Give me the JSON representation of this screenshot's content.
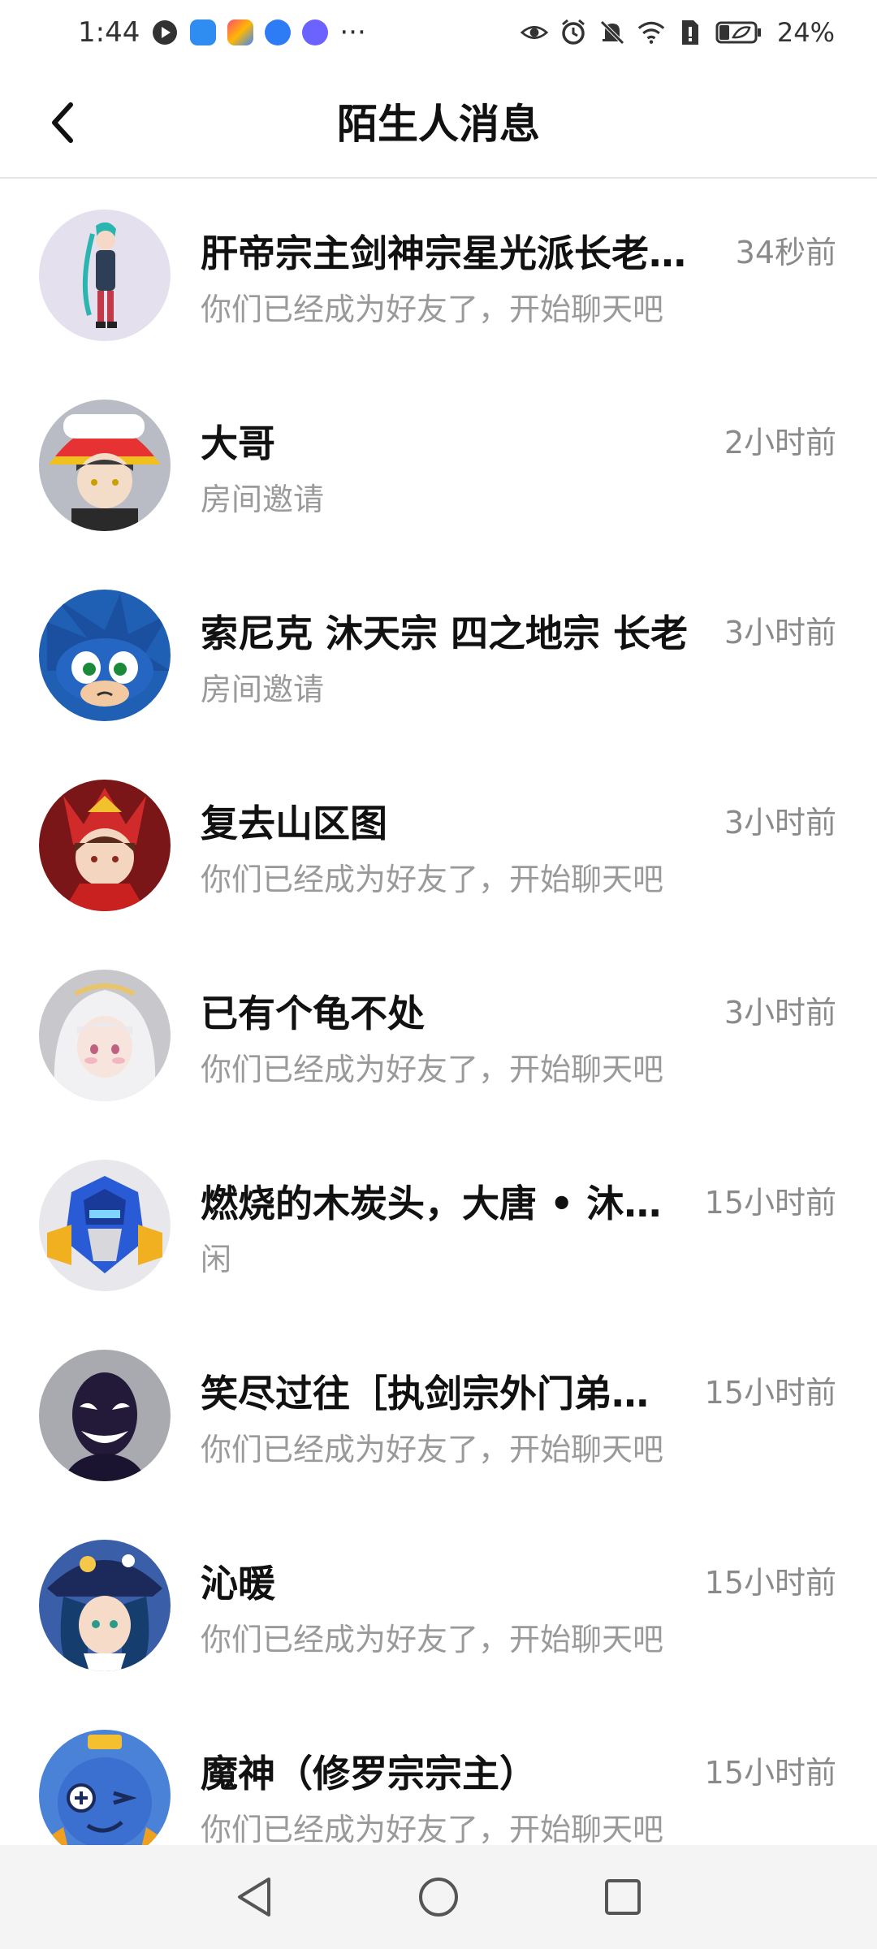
{
  "status_bar": {
    "time": "1:44",
    "ellipsis": "···",
    "battery_percent": "24%"
  },
  "header": {
    "title": "陌生人消息"
  },
  "conversations": [
    {
      "name": "肝帝宗主剑神宗星光派长老…",
      "time": "34秒前",
      "preview": "你们已经成为好友了，开始聊天吧"
    },
    {
      "name": "大哥",
      "time": "2小时前",
      "preview": "房间邀请"
    },
    {
      "name": "索尼克 沐天宗 四之地宗 长老",
      "time": "3小时前",
      "preview": "房间邀请"
    },
    {
      "name": "复去山区图",
      "time": "3小时前",
      "preview": "你们已经成为好友了，开始聊天吧"
    },
    {
      "name": "已有个龟不处",
      "time": "3小时前",
      "preview": "你们已经成为好友了，开始聊天吧"
    },
    {
      "name": "燃烧的木炭头，大唐 • 沐…",
      "time": "15小时前",
      "preview": "闲"
    },
    {
      "name": "笑尽过往［执剑宗外门弟…",
      "time": "15小时前",
      "preview": "你们已经成为好友了，开始聊天吧"
    },
    {
      "name": "沁暖",
      "time": "15小时前",
      "preview": "你们已经成为好友了，开始聊天吧"
    },
    {
      "name": "魔神（修罗宗宗主）",
      "time": "15小时前",
      "preview": "你们已经成为好友了，开始聊天吧"
    }
  ]
}
